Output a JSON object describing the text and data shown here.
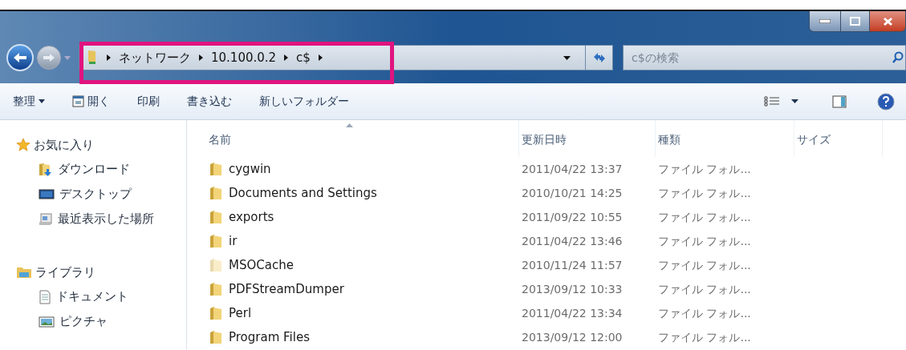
{
  "address_bar": {
    "crumbs": [
      "ネットワーク",
      "10.100.0.2",
      "c$"
    ]
  },
  "search": {
    "placeholder": "c$の検索"
  },
  "toolbar": {
    "items": [
      {
        "label": "整理",
        "kind": "menu"
      },
      {
        "label": "開く",
        "kind": "icon"
      },
      {
        "label": "印刷",
        "kind": "plain"
      },
      {
        "label": "書き込む",
        "kind": "plain"
      },
      {
        "label": "新しいフォルダー",
        "kind": "plain"
      }
    ]
  },
  "sidebar": {
    "groups": [
      {
        "label": "お気に入り",
        "kind": "favorites",
        "items": [
          {
            "label": "ダウンロード",
            "kind": "downloads"
          },
          {
            "label": "デスクトップ",
            "kind": "desktop"
          },
          {
            "label": "最近表示した場所",
            "kind": "recent"
          }
        ]
      },
      {
        "label": "ライブラリ",
        "kind": "libraries",
        "items": [
          {
            "label": "ドキュメント",
            "kind": "documents"
          },
          {
            "label": "ピクチャ",
            "kind": "pictures"
          }
        ]
      }
    ]
  },
  "table": {
    "columns": [
      "名前",
      "更新日時",
      "種類",
      "サイズ"
    ],
    "rows": [
      {
        "name": "cygwin",
        "modified": "2011/04/22 13:37",
        "type": "ファイル フォル...",
        "hidden": false
      },
      {
        "name": "Documents and Settings",
        "modified": "2010/10/21 14:25",
        "type": "ファイル フォル...",
        "hidden": false
      },
      {
        "name": "exports",
        "modified": "2011/09/22 10:55",
        "type": "ファイル フォル...",
        "hidden": false
      },
      {
        "name": "ir",
        "modified": "2011/04/22 13:46",
        "type": "ファイル フォル...",
        "hidden": false
      },
      {
        "name": "MSOCache",
        "modified": "2010/11/24 11:57",
        "type": "ファイル フォル...",
        "hidden": true
      },
      {
        "name": "PDFStreamDumper",
        "modified": "2013/09/12 10:33",
        "type": "ファイル フォル...",
        "hidden": false
      },
      {
        "name": "Perl",
        "modified": "2011/04/22 13:34",
        "type": "ファイル フォル...",
        "hidden": false
      },
      {
        "name": "Program Files",
        "modified": "2013/09/12 12:00",
        "type": "ファイル フォル...",
        "hidden": false
      }
    ]
  }
}
